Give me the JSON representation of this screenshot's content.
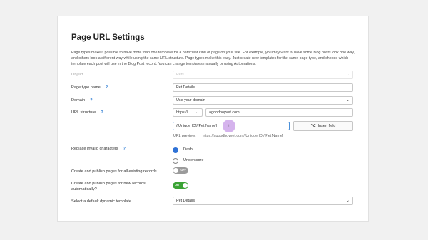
{
  "page_title": "Page URL Settings",
  "description": "Page types make it possible to have more than one template for a particular kind of page on your site. For example, you may want to have some blog posts look one way, and others look a different way while using the same URL structure. Page types make this easy. Just create new templates for the same page type, and choose which template each post will use in the Blog Post record. You can change templates manually or using Automations.",
  "help_glyph": "?",
  "object": {
    "label": "Object",
    "value": "Pets"
  },
  "page_type_name": {
    "label": "Page type name",
    "value": "Pet Details"
  },
  "domain": {
    "label": "Domain",
    "value": "Use your domain"
  },
  "url_structure": {
    "label": "URL structure",
    "protocol": "https://",
    "host": "agoodboyvet.com",
    "path": "/[Unique ID]/[Pet Name]",
    "insert_button": "Insert field",
    "preview_label": "URL preview:",
    "preview_value": "https://agoodboyvet.com/[Unique ID]/[Pet Name]"
  },
  "replace_invalid": {
    "label": "Replace invalid characters",
    "options": [
      "Dash",
      "Underscore"
    ],
    "selected": "Dash"
  },
  "publish_existing": {
    "label": "Create and publish pages for all existing records",
    "state": "OFF"
  },
  "publish_new": {
    "label": "Create and publish pages for new records automatically?",
    "state": "ON"
  },
  "default_template": {
    "label": "Select a default dynamic template",
    "value": "Pet Details"
  },
  "chevron_glyph": "⌄",
  "colors": {
    "accent_blue": "#2f72d6",
    "toggle_on": "#3aa334",
    "toggle_off": "#9b9b9b",
    "cursor_highlight": "#cba0e8"
  }
}
